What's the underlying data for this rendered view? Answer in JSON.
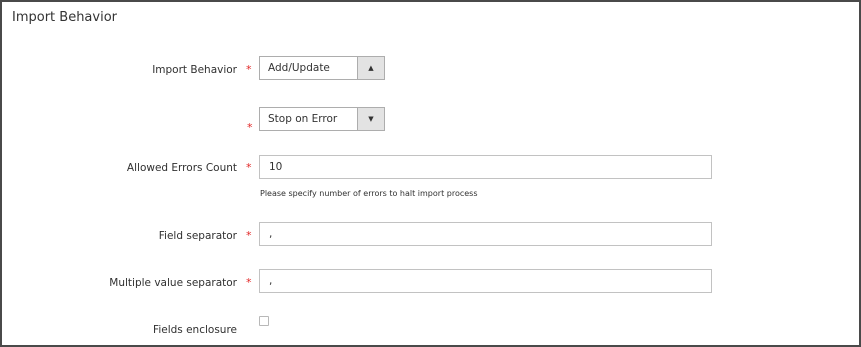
{
  "section": {
    "title": "Import Behavior"
  },
  "fields": {
    "import_behavior": {
      "label": "Import Behavior",
      "required_mark": "*",
      "value": "Add/Update",
      "arrow": "▲"
    },
    "validation_strategy": {
      "label": "",
      "required_mark": "*",
      "value": "Stop on Error",
      "arrow": "▼"
    },
    "allowed_errors_count": {
      "label": "Allowed Errors Count",
      "required_mark": "*",
      "value": "10",
      "note": "Please specify number of errors to halt import process"
    },
    "field_separator": {
      "label": "Field separator",
      "required_mark": "*",
      "value": ","
    },
    "multiple_value_separator": {
      "label": "Multiple value separator",
      "required_mark": "*",
      "value": ","
    },
    "fields_enclosure": {
      "label": "Fields enclosure",
      "checked": false
    }
  },
  "colors": {
    "required": "#e22626",
    "border": "#4a4a4a",
    "select_arrow_bg": "#e3e3e3"
  }
}
